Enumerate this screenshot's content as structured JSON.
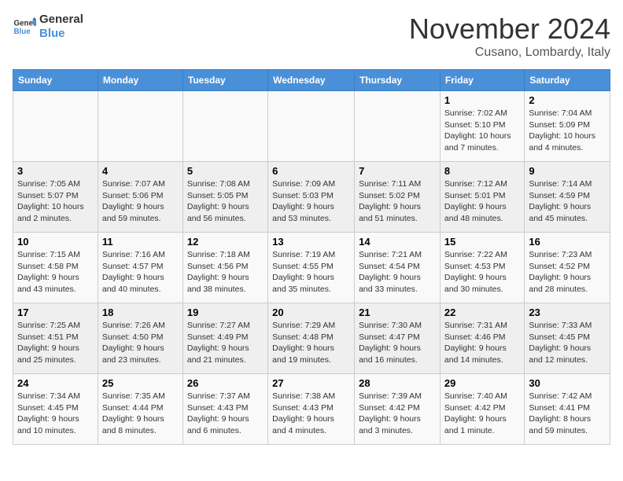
{
  "header": {
    "logo_general": "General",
    "logo_blue": "Blue",
    "month_title": "November 2024",
    "location": "Cusano, Lombardy, Italy"
  },
  "weekdays": [
    "Sunday",
    "Monday",
    "Tuesday",
    "Wednesday",
    "Thursday",
    "Friday",
    "Saturday"
  ],
  "weeks": [
    [
      {
        "day": "",
        "info": ""
      },
      {
        "day": "",
        "info": ""
      },
      {
        "day": "",
        "info": ""
      },
      {
        "day": "",
        "info": ""
      },
      {
        "day": "",
        "info": ""
      },
      {
        "day": "1",
        "info": "Sunrise: 7:02 AM\nSunset: 5:10 PM\nDaylight: 10 hours and 7 minutes."
      },
      {
        "day": "2",
        "info": "Sunrise: 7:04 AM\nSunset: 5:09 PM\nDaylight: 10 hours and 4 minutes."
      }
    ],
    [
      {
        "day": "3",
        "info": "Sunrise: 7:05 AM\nSunset: 5:07 PM\nDaylight: 10 hours and 2 minutes."
      },
      {
        "day": "4",
        "info": "Sunrise: 7:07 AM\nSunset: 5:06 PM\nDaylight: 9 hours and 59 minutes."
      },
      {
        "day": "5",
        "info": "Sunrise: 7:08 AM\nSunset: 5:05 PM\nDaylight: 9 hours and 56 minutes."
      },
      {
        "day": "6",
        "info": "Sunrise: 7:09 AM\nSunset: 5:03 PM\nDaylight: 9 hours and 53 minutes."
      },
      {
        "day": "7",
        "info": "Sunrise: 7:11 AM\nSunset: 5:02 PM\nDaylight: 9 hours and 51 minutes."
      },
      {
        "day": "8",
        "info": "Sunrise: 7:12 AM\nSunset: 5:01 PM\nDaylight: 9 hours and 48 minutes."
      },
      {
        "day": "9",
        "info": "Sunrise: 7:14 AM\nSunset: 4:59 PM\nDaylight: 9 hours and 45 minutes."
      }
    ],
    [
      {
        "day": "10",
        "info": "Sunrise: 7:15 AM\nSunset: 4:58 PM\nDaylight: 9 hours and 43 minutes."
      },
      {
        "day": "11",
        "info": "Sunrise: 7:16 AM\nSunset: 4:57 PM\nDaylight: 9 hours and 40 minutes."
      },
      {
        "day": "12",
        "info": "Sunrise: 7:18 AM\nSunset: 4:56 PM\nDaylight: 9 hours and 38 minutes."
      },
      {
        "day": "13",
        "info": "Sunrise: 7:19 AM\nSunset: 4:55 PM\nDaylight: 9 hours and 35 minutes."
      },
      {
        "day": "14",
        "info": "Sunrise: 7:21 AM\nSunset: 4:54 PM\nDaylight: 9 hours and 33 minutes."
      },
      {
        "day": "15",
        "info": "Sunrise: 7:22 AM\nSunset: 4:53 PM\nDaylight: 9 hours and 30 minutes."
      },
      {
        "day": "16",
        "info": "Sunrise: 7:23 AM\nSunset: 4:52 PM\nDaylight: 9 hours and 28 minutes."
      }
    ],
    [
      {
        "day": "17",
        "info": "Sunrise: 7:25 AM\nSunset: 4:51 PM\nDaylight: 9 hours and 25 minutes."
      },
      {
        "day": "18",
        "info": "Sunrise: 7:26 AM\nSunset: 4:50 PM\nDaylight: 9 hours and 23 minutes."
      },
      {
        "day": "19",
        "info": "Sunrise: 7:27 AM\nSunset: 4:49 PM\nDaylight: 9 hours and 21 minutes."
      },
      {
        "day": "20",
        "info": "Sunrise: 7:29 AM\nSunset: 4:48 PM\nDaylight: 9 hours and 19 minutes."
      },
      {
        "day": "21",
        "info": "Sunrise: 7:30 AM\nSunset: 4:47 PM\nDaylight: 9 hours and 16 minutes."
      },
      {
        "day": "22",
        "info": "Sunrise: 7:31 AM\nSunset: 4:46 PM\nDaylight: 9 hours and 14 minutes."
      },
      {
        "day": "23",
        "info": "Sunrise: 7:33 AM\nSunset: 4:45 PM\nDaylight: 9 hours and 12 minutes."
      }
    ],
    [
      {
        "day": "24",
        "info": "Sunrise: 7:34 AM\nSunset: 4:45 PM\nDaylight: 9 hours and 10 minutes."
      },
      {
        "day": "25",
        "info": "Sunrise: 7:35 AM\nSunset: 4:44 PM\nDaylight: 9 hours and 8 minutes."
      },
      {
        "day": "26",
        "info": "Sunrise: 7:37 AM\nSunset: 4:43 PM\nDaylight: 9 hours and 6 minutes."
      },
      {
        "day": "27",
        "info": "Sunrise: 7:38 AM\nSunset: 4:43 PM\nDaylight: 9 hours and 4 minutes."
      },
      {
        "day": "28",
        "info": "Sunrise: 7:39 AM\nSunset: 4:42 PM\nDaylight: 9 hours and 3 minutes."
      },
      {
        "day": "29",
        "info": "Sunrise: 7:40 AM\nSunset: 4:42 PM\nDaylight: 9 hours and 1 minute."
      },
      {
        "day": "30",
        "info": "Sunrise: 7:42 AM\nSunset: 4:41 PM\nDaylight: 8 hours and 59 minutes."
      }
    ]
  ]
}
